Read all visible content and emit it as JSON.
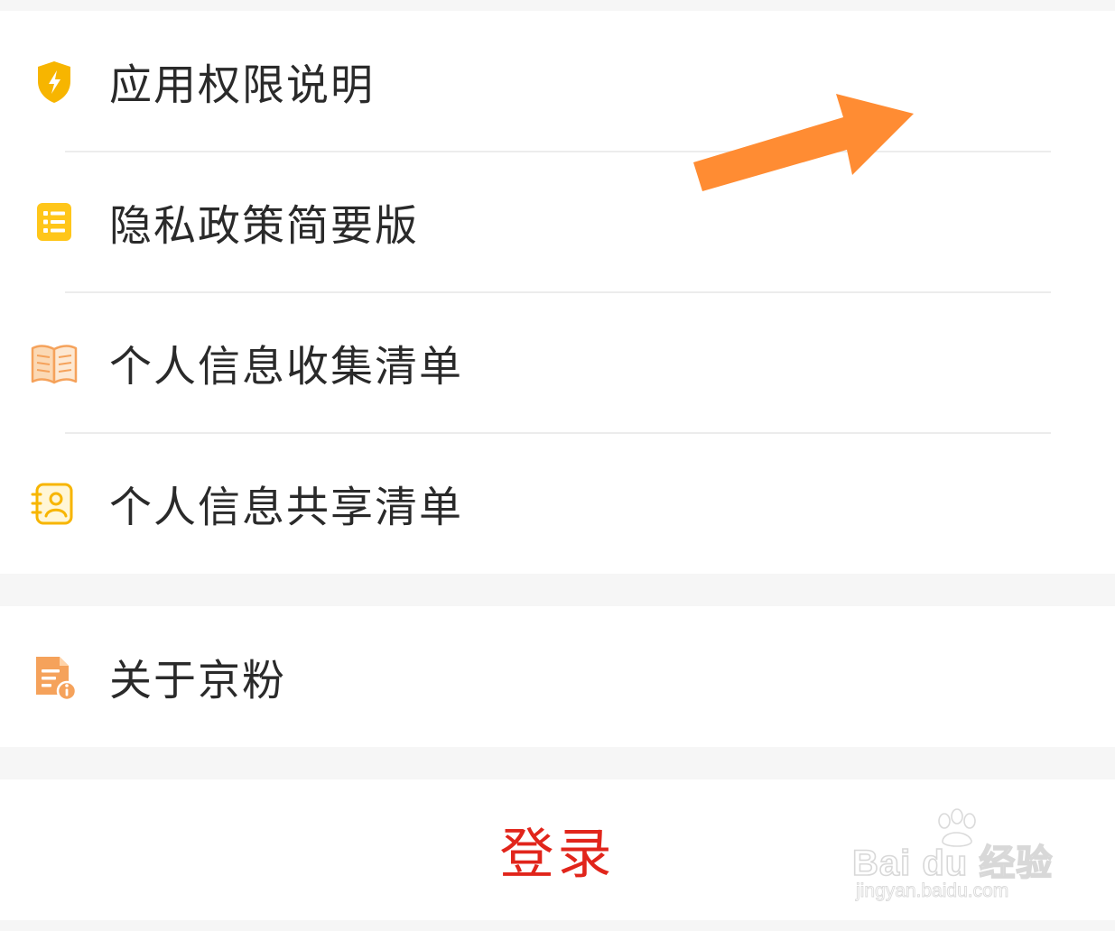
{
  "menu": {
    "items": [
      {
        "label": "应用权限说明",
        "icon": "shield-icon"
      },
      {
        "label": "隐私政策简要版",
        "icon": "list-document-icon"
      },
      {
        "label": "个人信息收集清单",
        "icon": "open-book-icon"
      },
      {
        "label": "个人信息共享清单",
        "icon": "contact-card-icon"
      }
    ]
  },
  "about": {
    "label": "关于京粉",
    "icon": "document-info-icon"
  },
  "login": {
    "label": "登录"
  },
  "watermark": {
    "brand": "Bai du 经验",
    "url": "jingyan.baidu.com"
  },
  "colors": {
    "login_text": "#e1251b",
    "icon_yellow": "#f7b500",
    "icon_orange": "#f5a25b",
    "annotation_arrow": "#ff8c33",
    "background": "#f6f6f6"
  }
}
